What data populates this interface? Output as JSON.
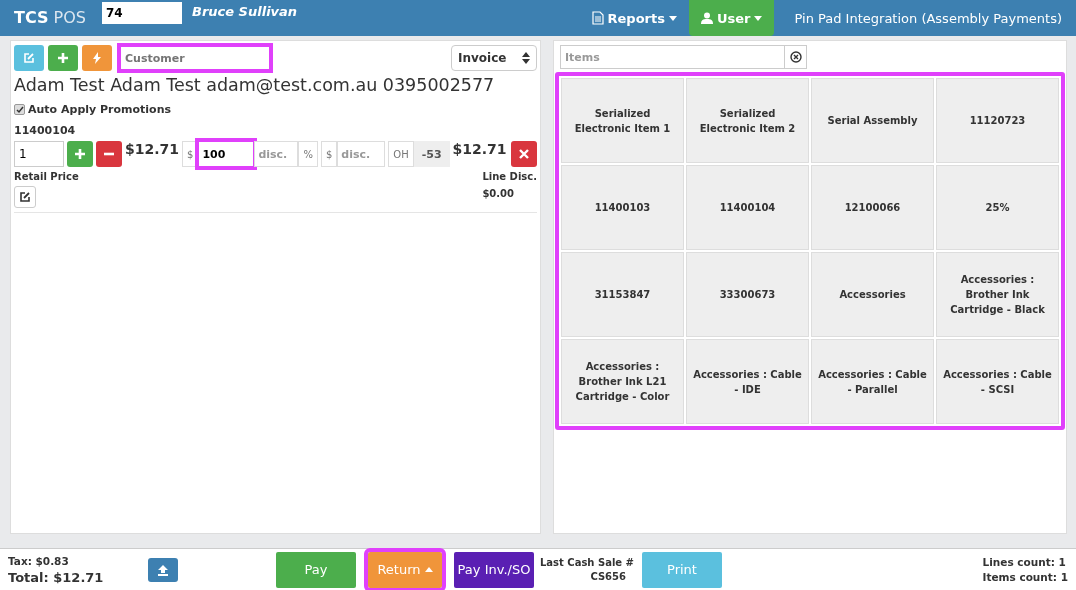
{
  "topbar": {
    "brand_bold": "TCS",
    "brand_light": "POS",
    "register_field": {
      "value": "74"
    },
    "user_name": "Bruce Sullivan",
    "menus": [
      {
        "label": "Reports",
        "kind": "report",
        "selected": false
      },
      {
        "label": "User",
        "kind": "user",
        "selected": true
      }
    ],
    "integration": "Pin Pad Integration (Assembly Payments)"
  },
  "sale": {
    "customer_field": {
      "placeholder": "Customer",
      "highlighted": true
    },
    "doc_type": "Invoice",
    "customer_info": "Adam Test Adam Test adam@test.com.au 0395002577",
    "auto_promotions": {
      "label": "Auto Apply Promotions",
      "checked": true
    },
    "line": {
      "code": "11400104",
      "qty": "1",
      "price": "$12.71",
      "percent_prefix": "$",
      "percent_value": "100",
      "percent_highlighted": true,
      "percent_placeholder": "disc.",
      "percent_suffix": "%",
      "amount_prefix": "$",
      "amount_placeholder": "disc.",
      "oh_label": "OH",
      "oh_value": "-53",
      "total": "$12.71",
      "retail_label": "Retail Price",
      "line_disc_label": "Line Disc.",
      "line_disc_value": "$0.00"
    }
  },
  "items": {
    "search_placeholder": "Items",
    "highlighted": true,
    "tiles": [
      "Serialized Electronic Item 1",
      "Serialized Electronic Item 2",
      "Serial Assembly",
      "11120723",
      "11400103",
      "11400104",
      "12100066",
      "25%",
      "31153847",
      "33300673",
      "Accessories",
      "Accessories : Brother Ink Cartridge - Black",
      "Accessories : Brother Ink L21 Cartridge - Color",
      "Accessories : Cable - IDE",
      "Accessories : Cable - Parallel",
      "Accessories : Cable - SCSI"
    ]
  },
  "footer": {
    "tax": "Tax: $0.83",
    "total": "Total: $12.71",
    "buttons": [
      {
        "label": "Pay",
        "kind": "pay",
        "highlighted": false
      },
      {
        "label": "Return",
        "kind": "return",
        "highlighted": true
      },
      {
        "label": "Pay Inv./SO",
        "kind": "payinv",
        "highlighted": false
      }
    ],
    "last_sale_label": "Last Cash Sale #",
    "last_sale_value": "CS656",
    "print": "Print",
    "lines_count": "Lines count: 1",
    "items_count": "Items count: 1"
  }
}
